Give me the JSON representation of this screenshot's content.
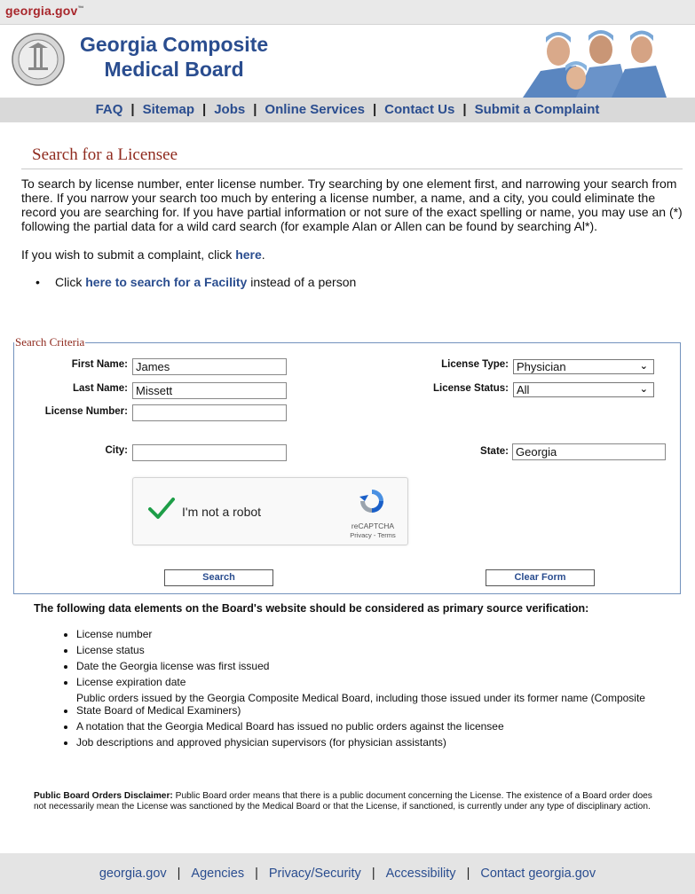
{
  "gov_logo": {
    "text": "georgia.gov",
    "tm": "™"
  },
  "header": {
    "title_line1": "Georgia Composite",
    "title_line2": "Medical Board"
  },
  "nav": {
    "items": [
      {
        "label": "FAQ"
      },
      {
        "label": "Sitemap"
      },
      {
        "label": "Jobs"
      },
      {
        "label": "Online Services"
      },
      {
        "label": "Contact Us"
      },
      {
        "label": "Submit a Complaint"
      }
    ],
    "separator": "|"
  },
  "page": {
    "heading": "Search for a Licensee",
    "intro": "To search by license number, enter license number. Try searching by one element first, and narrowing your search from there. If you narrow your search too much by entering a license number, a name, and a city, you could eliminate the record you are searching for. If you have partial information or not sure of the exact spelling or name, you may use an (*) following the partial data for a wild card search (for example Alan or Allen can be found by searching Al*).",
    "complaint_prefix": "If you wish to submit a complaint, click ",
    "complaint_link": "here",
    "complaint_suffix": ".",
    "facility_prefix": "Click ",
    "facility_link": "here to search for a Facility",
    "facility_suffix": " instead of a person"
  },
  "form": {
    "legend": "Search Criteria",
    "first_name_label": "First Name:",
    "first_name_value": "James",
    "last_name_label": "Last Name:",
    "last_name_value": "Missett",
    "license_number_label": "License Number:",
    "license_number_value": "",
    "city_label": "City:",
    "city_value": "",
    "license_type_label": "License Type:",
    "license_type_value": "Physician",
    "license_status_label": "License Status:",
    "license_status_value": "All",
    "state_label": "State:",
    "state_value": "Georgia",
    "captcha_text": "I'm not a robot",
    "captcha_brand": "reCAPTCHA",
    "captcha_terms": "Privacy - Terms",
    "search_button": "Search",
    "clear_button": "Clear Form"
  },
  "verification": {
    "heading": "The following data elements on the Board's website should be considered as primary source verification:",
    "items": [
      "License number",
      "License status",
      "Date the Georgia license was first issued",
      "License expiration date",
      "Public orders issued by the Georgia Composite Medical Board, including those issued under its former name (Composite State Board of Medical Examiners)",
      "A notation that the Georgia Medical Board has issued no public orders against the licensee",
      "Job descriptions and approved physician supervisors (for physician assistants)"
    ]
  },
  "disclaimer": {
    "label": "Public Board Orders Disclaimer:",
    "text": " Public Board order means that there is a public document concerning the License. The existence of a Board order does not necessarily mean the License was sanctioned by the Medical Board or that the License, if sanctioned, is currently under any type of disciplinary action."
  },
  "footer": {
    "items": [
      {
        "label": "georgia.gov"
      },
      {
        "label": "Agencies"
      },
      {
        "label": "Privacy/Security"
      },
      {
        "label": "Accessibility"
      },
      {
        "label": "Contact georgia.gov"
      }
    ],
    "separator": "|"
  },
  "colors": {
    "link_blue": "#2a4d8f",
    "heading_red": "#8f2a1e",
    "nav_gray": "#d9d9d9",
    "footer_gray": "#e4e4e4"
  }
}
